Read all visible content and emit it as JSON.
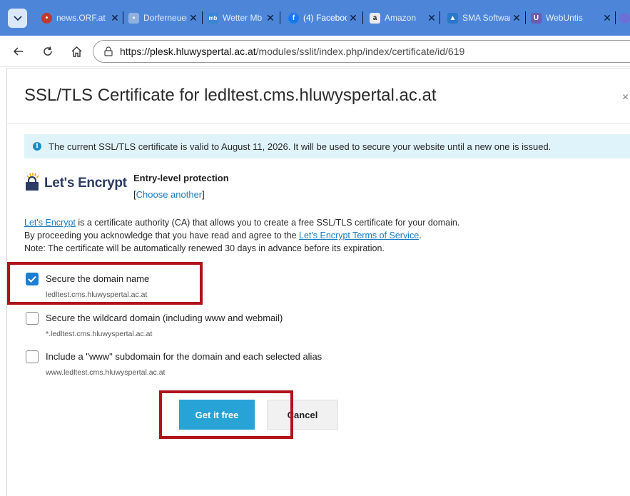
{
  "tabs": [
    {
      "title": "news.ORF.at",
      "favicon": "orf-icon",
      "color": "#c0392b"
    },
    {
      "title": "Dorferneuerung",
      "favicon": "dorf-icon",
      "color": "#6a8fc4"
    },
    {
      "title": "Wetter Mb",
      "favicon": "mb-icon",
      "color": "#2d7bd3"
    },
    {
      "title": "(4) Facebook",
      "favicon": "facebook-icon",
      "color": "#1877f2"
    },
    {
      "title": "Amazon",
      "favicon": "amazon-icon",
      "color": "#555555"
    },
    {
      "title": "SMA Software",
      "favicon": "sma-icon",
      "color": "#2a78c9"
    },
    {
      "title": "WebUntis",
      "favicon": "webuntis-icon",
      "color": "#6e5bb5"
    }
  ],
  "address": {
    "scheme": "https://",
    "host": "plesk.hluwyspertal.ac.at",
    "path": "/modules/sslit/index.php/index/certificate/id/619"
  },
  "dialog": {
    "title": "SSL/TLS Certificate for ledltest.cms.hluwyspertal.ac.at",
    "close": "×",
    "info": "The current SSL/TLS certificate is valid to August 11, 2026. It will be used to secure your website until a new one is issued.",
    "provider": {
      "name": "Let's Encrypt",
      "protection": "Entry-level protection",
      "choose_open": "[",
      "choose_link": "Choose another",
      "choose_close": "]"
    },
    "description": {
      "line1_link": "Let's Encrypt",
      "line1_rest": " is a certificate authority (CA) that allows you to create a free SSL/TLS certificate for your domain.",
      "line2_pre": "By proceeding you acknowledge that you have read and agree to the ",
      "line2_link": "Let's Encrypt Terms of Service",
      "line2_post": ".",
      "line3": "Note: The certificate will be automatically renewed 30 days in advance before its expiration."
    },
    "options": [
      {
        "label": "Secure the domain name",
        "sub": "ledltest.cms.hluwyspertal.ac.at",
        "checked": true
      },
      {
        "label": "Secure the wildcard domain (including www and webmail)",
        "sub": "*.ledltest.cms.hluwyspertal.ac.at",
        "checked": false
      },
      {
        "label": "Include a \"www\" subdomain for the domain and each selected alias",
        "sub": "www.ledltest.cms.hluwyspertal.ac.at",
        "checked": false
      }
    ],
    "buttons": {
      "primary": "Get it free",
      "cancel": "Cancel"
    }
  },
  "colors": {
    "accent": "#28a3d6",
    "highlight": "#b0121b",
    "checkbox": "#1a7fd4",
    "tabstrip": "#4d86d9"
  }
}
